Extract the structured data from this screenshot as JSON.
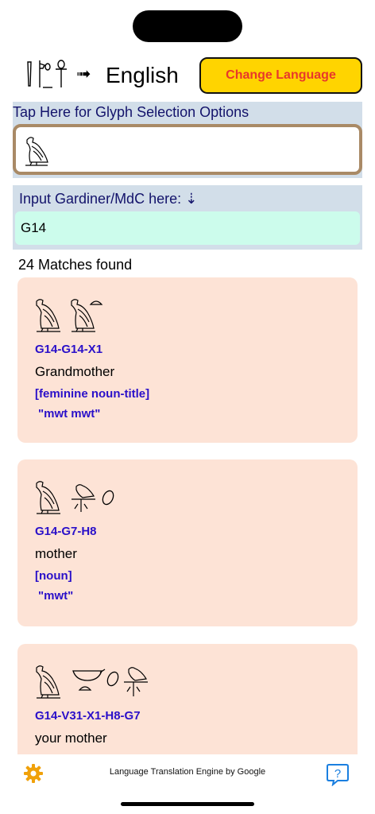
{
  "header": {
    "title_glyph_icon": "hieroglyph-title-icon",
    "arrow": "➟",
    "target_language": "English",
    "change_language_label": "Change Language"
  },
  "glyph_options": {
    "label": "Tap Here for Glyph Selection Options",
    "selected_glyph_icon": "vulture-hieroglyph-icon"
  },
  "mdc_input": {
    "label": "Input Gardiner/MdC here: ⇣",
    "value": "G14"
  },
  "results": {
    "count_text": "24 Matches found",
    "items": [
      {
        "glyph_icons": [
          "vulture-glyph-icon",
          "vulture-glyph-icon",
          "bread-loaf-glyph-icon"
        ],
        "code": "G14-G14-X1",
        "meaning": "Grandmother",
        "part_of_speech": "[feminine noun-title]",
        "transliteration": "\"mwt mwt\""
      },
      {
        "glyph_icons": [
          "vulture-glyph-icon",
          "falcon-on-standard-glyph-icon",
          "egg-glyph-icon"
        ],
        "code": "G14-G7-H8",
        "meaning": "mother",
        "part_of_speech": "[noun]",
        "transliteration": "\"mwt\""
      },
      {
        "glyph_icons": [
          "vulture-glyph-icon",
          "basket-glyph-icon",
          "bread-loaf-glyph-icon",
          "egg-glyph-icon",
          "falcon-on-standard-glyph-icon"
        ],
        "code": "G14-V31-X1-H8-G7",
        "meaning": "your mother",
        "part_of_speech": "",
        "transliteration": ""
      }
    ]
  },
  "footer": {
    "settings_icon": "gear-icon",
    "engine_text": "Language Translation Engine by Google",
    "help_icon": "help-bubble-icon"
  },
  "colors": {
    "accent_yellow": "#ffd400",
    "button_text_red": "#e8382b",
    "panel_blue": "#d2dee9",
    "input_mint": "#ccfcec",
    "card_peach": "#fde3d6",
    "code_blue": "#2a10c9",
    "gear_orange": "#f0a10a",
    "help_blue": "#1a7fe0"
  }
}
